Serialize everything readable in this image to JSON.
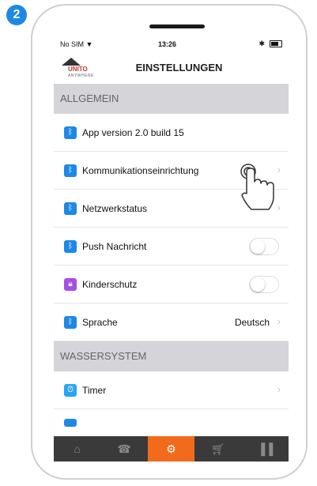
{
  "step_number": "2",
  "status_bar": {
    "carrier": "No SIM",
    "time": "13:26"
  },
  "header": {
    "logo_text": "UNITO",
    "logo_subtext": "ANYWHERE",
    "title": "EINSTELLUNGEN"
  },
  "sections": [
    {
      "title": "ALLGEMEIN",
      "rows": [
        {
          "label": "App version 2.0 build 15",
          "icon": "bluetooth-icon",
          "control": "none"
        },
        {
          "label": "Kommunikationseinrichtung",
          "icon": "bluetooth-icon",
          "control": "chevron"
        },
        {
          "label": "Netzwerkstatus",
          "icon": "bluetooth-icon",
          "control": "chevron"
        },
        {
          "label": "Push Nachricht",
          "icon": "bluetooth-icon",
          "control": "toggle",
          "on": false
        },
        {
          "label": "Kinderschutz",
          "icon": "lock-icon",
          "control": "toggle",
          "on": false
        },
        {
          "label": "Sprache",
          "icon": "bluetooth-icon",
          "control": "chevron",
          "value": "Deutsch"
        }
      ]
    },
    {
      "title": "WASSERSYSTEM",
      "rows": [
        {
          "label": "Timer",
          "icon": "timer-icon",
          "control": "chevron"
        }
      ]
    }
  ],
  "tab_bar": [
    {
      "icon": "home-icon",
      "active": false
    },
    {
      "icon": "phone-icon",
      "active": false
    },
    {
      "icon": "settings-gear-icon",
      "active": true
    },
    {
      "icon": "cart-icon",
      "active": false
    },
    {
      "icon": "bar-chart-icon",
      "active": false
    }
  ],
  "colors": {
    "accent_orange": "#f26b1d",
    "row_icon_blue": "#1e88e5",
    "lock_icon_purple": "#a64ee6",
    "section_gray": "#d4d4d9"
  }
}
